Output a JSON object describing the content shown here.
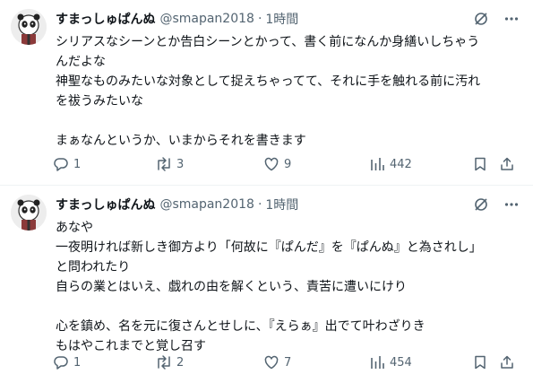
{
  "tweets": [
    {
      "name": "すまっしゅぱんぬ",
      "handle": "@smapan2018",
      "dot": "·",
      "time": "1時間",
      "lines": [
        "シリアスなシーンとか告白シーンとかって、書く前になんか身繕いしちゃう",
        "んだよな",
        "神聖なものみたいな対象として捉えちゃってて、それに手を触れる前に汚れ",
        "を祓うみたいな",
        "",
        "まぁなんというか、いまからそれを書きます"
      ],
      "replies": "1",
      "reposts": "3",
      "likes": "9",
      "views": "442"
    },
    {
      "name": "すまっしゅぱんぬ",
      "handle": "@smapan2018",
      "dot": "·",
      "time": "1時間",
      "lines": [
        "あなや",
        "一夜明ければ新しき御方より「何故に『ぱんだ』を『ぱんぬ』と為されし」",
        "と問われたり",
        "自らの業とはいえ、戯れの由を解くという、責苦に遭いにけり",
        "",
        "心を鎮め、名を元に復さんとせしに、『えらぁ』出でて叶わざりき",
        "もはやこれまでと覚し召す"
      ],
      "replies": "1",
      "reposts": "2",
      "likes": "7",
      "views": "454"
    }
  ],
  "icons": {
    "avatar": "panda-avatar-icon",
    "grok": "grok-icon",
    "more": "more-icon",
    "reply": "reply-icon",
    "repost": "repost-icon",
    "like": "heart-icon",
    "views": "views-icon",
    "bookmark": "bookmark-icon",
    "share": "share-icon"
  },
  "colors": {
    "text": "#0f1419",
    "secondary": "#536471",
    "divider": "#eff3f4"
  }
}
